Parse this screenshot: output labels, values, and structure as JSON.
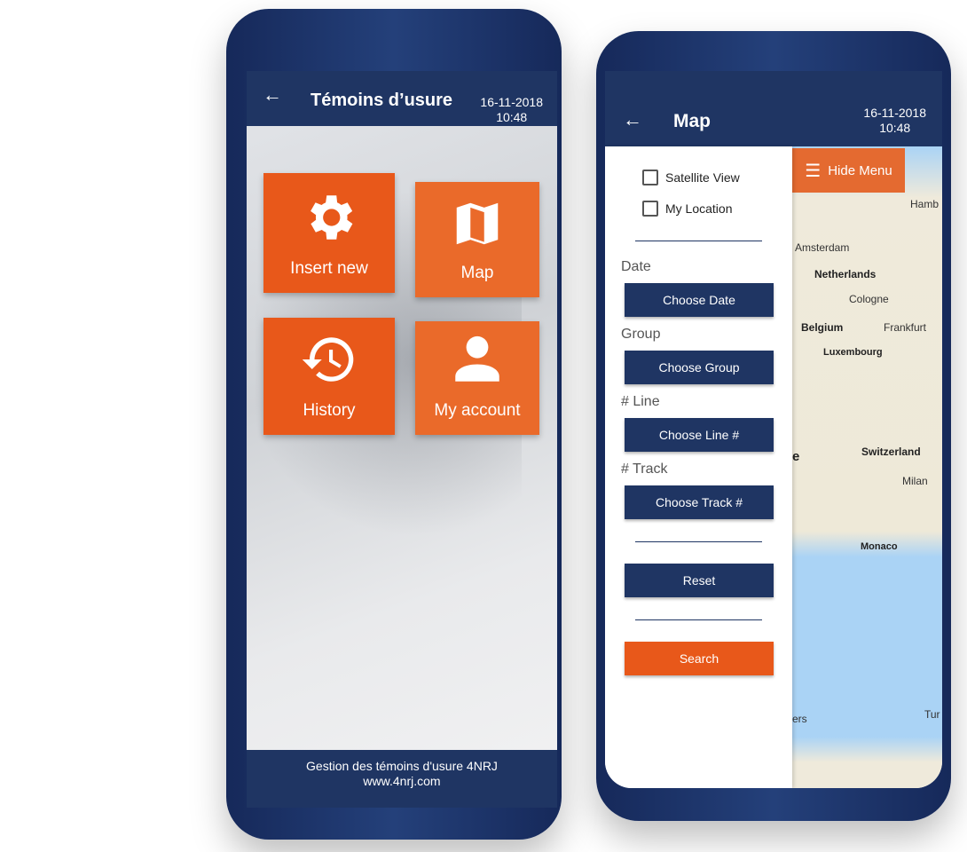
{
  "left_phone": {
    "header": {
      "title": "Témoins d’usure",
      "date": "16-11-2018",
      "time": "10:48"
    },
    "tiles": [
      {
        "label": "Insert new",
        "icon": "gear-icon"
      },
      {
        "label": "Map",
        "icon": "map-icon"
      },
      {
        "label": "History",
        "icon": "history-icon"
      },
      {
        "label": "My account",
        "icon": "user-icon"
      }
    ],
    "footer": {
      "line1": "Gestion des témoins d'usure 4NRJ",
      "line2": "www.4nrj.com"
    }
  },
  "right_phone": {
    "header": {
      "title": "Map",
      "date": "16-11-2018",
      "time": "10:48"
    },
    "menu": {
      "satellite": "Satellite View",
      "location": "My Location",
      "date_label": "Date",
      "date_btn": "Choose Date",
      "group_label": "Group",
      "group_btn": "Choose Group",
      "line_label": "# Line",
      "line_btn": "Choose Line #",
      "track_label": "# Track",
      "track_btn": "Choose Track #",
      "reset": "Reset",
      "search": "Search"
    },
    "hide_menu": "Hide Menu",
    "map_labels": [
      "Hamb",
      "Amsterdam",
      "Netherlands",
      "Cologne",
      "Belgium",
      "Frankfurt",
      "Luxembourg",
      "Switzerland",
      "e",
      "Milan",
      "Monaco",
      "ers",
      "Tur"
    ]
  },
  "colors": {
    "navy": "#1f3563",
    "orange": "#e8581a"
  }
}
